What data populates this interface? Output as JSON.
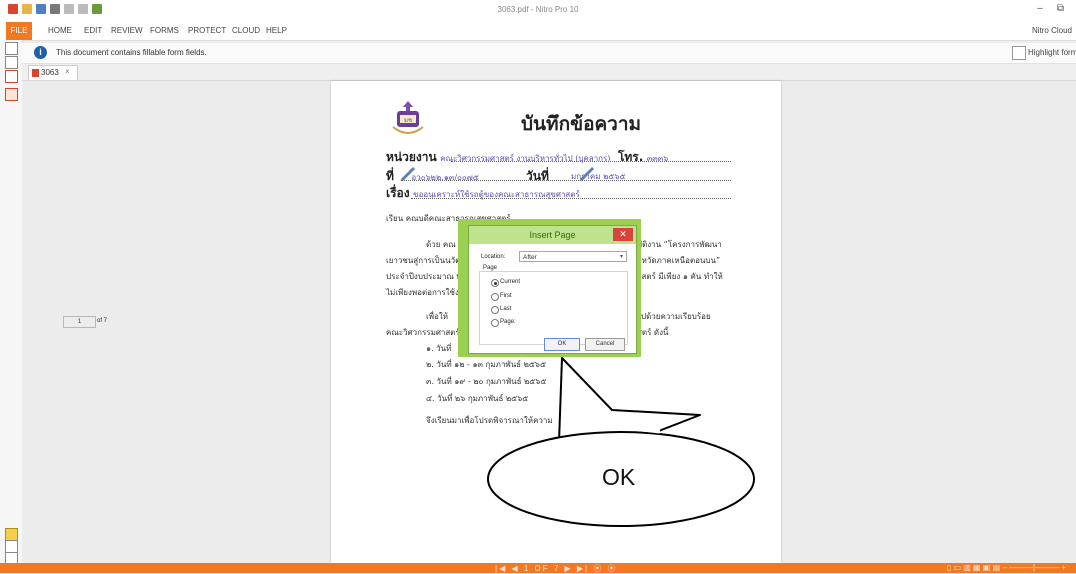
{
  "window": {
    "title": "3063.pdf - Nitro Pro 10",
    "controls": [
      "–",
      "⧉"
    ]
  },
  "ribbon": {
    "tabs": [
      "FILE",
      "HOME",
      "EDIT",
      "REVIEW",
      "FORMS",
      "PROTECT",
      "CLOUD",
      "HELP"
    ],
    "cloud_label": "Nitro Cloud"
  },
  "infobar": {
    "message": "This document contains fillable form fields.",
    "highlight_label": "Highlight form fields"
  },
  "doc_tab": {
    "name": "3063",
    "close": "×"
  },
  "memo": {
    "title": "บันทึกข้อความ",
    "agency_label": "หน่วยงาน",
    "agency_value": "คณะวิศวกรรมศาสตร์ งานบริหารทั่วไป (บุคลากร)",
    "tel_label": "โทร.",
    "tel_value": "๓๓๓๖",
    "ref_label": "ที่",
    "ref_value": "อว๐๖๒๒.๑๓/๐๐๗๕",
    "date_label": "วันที่",
    "date_value": "มกราคม ๒๕๖๕",
    "subject_label": "เรื่อง",
    "subject_value": "ขออนุเคราะห์ใช้รถตู้ของคณะสาธารณสุขศาสตร์",
    "salutation": "เรียน คณบดีคณะสาธารณสุขศาสตร์",
    "body_lines": [
      "ด้วย คณ",
      "บัติงาน “โครงการพัฒนา",
      "เยาวชนสู่การเป็นนวัตก",
      "จังหวัดภาคเหนือตอนบน”",
      "ประจำปีงบประมาณ พ.",
      "าสตร์ มีเพียง ๑ คัน ทำให้",
      "ไม่เพียงพอต่อการใช้งาน",
      "เพื่อให้",
      "ไปด้วยความเรียบร้อย",
      "คณะวิศวกรรมศาสตร์ จึ",
      "สตร์ ดังนี้",
      "๑. วันที่",
      "๒. วันที่ ๑๒ - ๑๓ กุมภาพันธ์ ๒๕๖๕",
      "๓. วันที่ ๑๙ - ๒๐ กุมภาพันธ์ ๒๕๖๕",
      "๔. วันที่ ๒๖ กุมภาพันธ์ ๒๕๖๕",
      "จึงเรียนมาเพื่อโปรดพิจารณาให้ความ"
    ]
  },
  "dialog": {
    "title": "Insert Page",
    "close": "✕",
    "location_label": "Location:",
    "location_value": "After",
    "group_label": "Page",
    "options": [
      "Current",
      "First",
      "Last",
      "Page:"
    ],
    "selected_option": "Current",
    "page_number": "1",
    "page_total": "of 7",
    "ok_label": "OK",
    "cancel_label": "Cancel"
  },
  "callout": {
    "text": "OK"
  },
  "statusbar": {
    "nav": "|◀ ◀  1 OF 7  ▶ ▶| ⦿ ⦿",
    "zoom": "▯ ▭ ▥ ▦ ▣ ▤  –  ———|———  +"
  },
  "colors": {
    "accent": "#f07a23",
    "dialog_frame": "#9ccf52",
    "close_red": "#d7443c",
    "fill_text": "#5a4fb0"
  }
}
